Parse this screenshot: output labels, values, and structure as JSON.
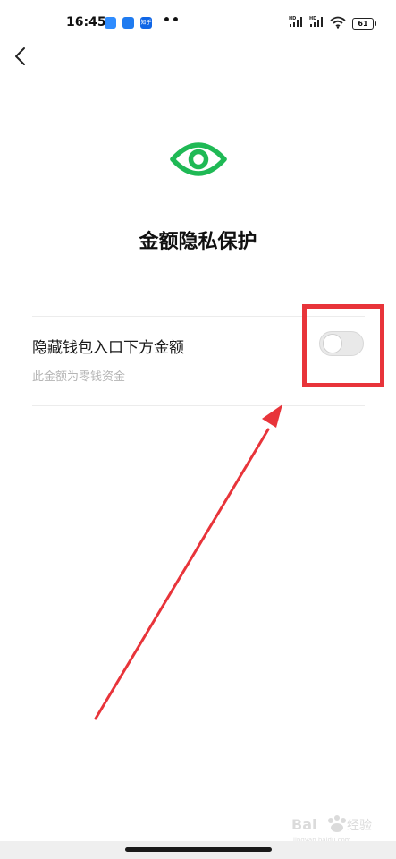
{
  "status_bar": {
    "time": "16:45",
    "notification_icons": [
      "telegram-icon",
      "app-icon",
      "zhihu-icon"
    ],
    "zhihu_text": "知乎",
    "more_indicator": "••",
    "battery_level": "61"
  },
  "nav": {
    "back_icon": "chevron-left-icon"
  },
  "header": {
    "icon": "eye-icon",
    "title": "金额隐私保护",
    "accent_color": "#1fb955"
  },
  "setting": {
    "label": "隐藏钱包入口下方金额",
    "sublabel": "此金额为零钱资金",
    "toggle_on": false
  },
  "annotation": {
    "box_color": "#e8343a",
    "arrow_color": "#e8343a"
  },
  "watermark": {
    "text": "Bai 经验",
    "subtext": "jingyan.baidu.com"
  }
}
